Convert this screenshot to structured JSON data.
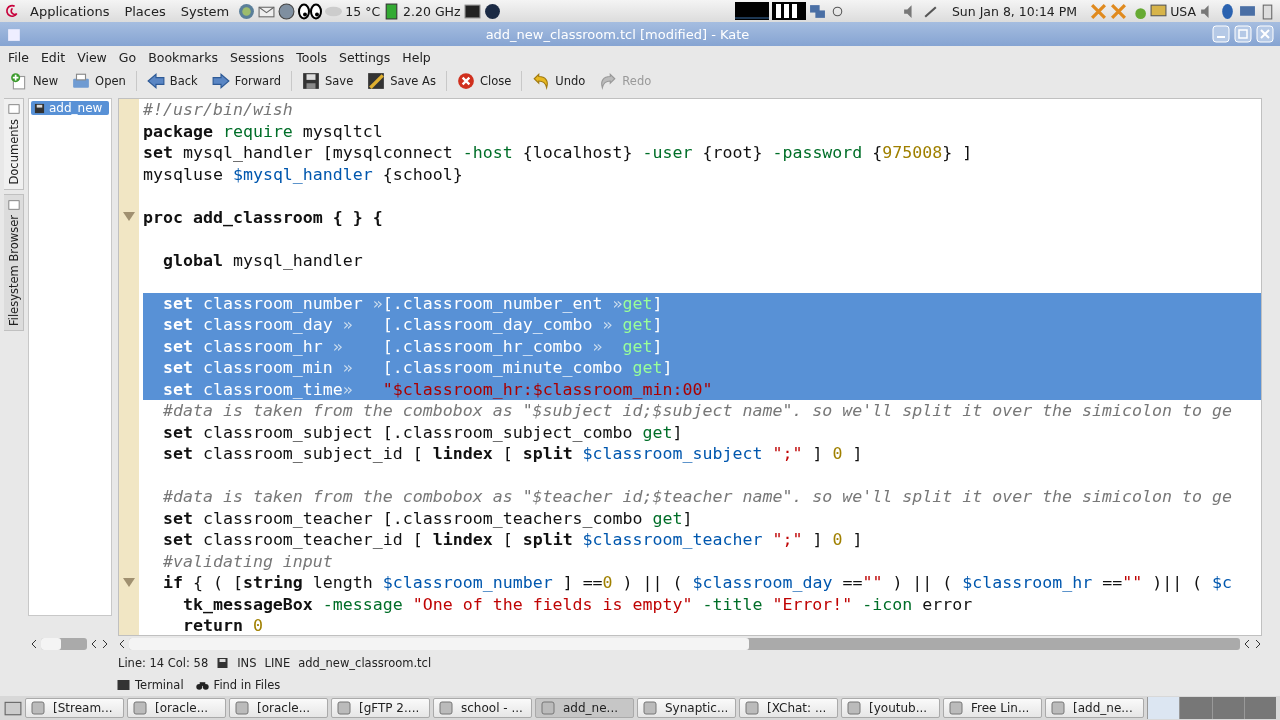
{
  "top_panel": {
    "menus": [
      "Applications",
      "Places",
      "System"
    ],
    "temperature": "15 °C",
    "cpu_speed": "2.20 GHz",
    "clock": "Sun Jan  8, 10:14 PM",
    "keyboard": "USA"
  },
  "window": {
    "title": "add_new_classroom.tcl [modified] - Kate"
  },
  "menu": [
    "File",
    "Edit",
    "View",
    "Go",
    "Bookmarks",
    "Sessions",
    "Tools",
    "Settings",
    "Help"
  ],
  "toolbar": [
    {
      "kind": "new",
      "label": "New",
      "disabled": false
    },
    {
      "kind": "open",
      "label": "Open",
      "disabled": false
    },
    {
      "kind": "back",
      "label": "Back",
      "disabled": false
    },
    {
      "kind": "forward",
      "label": "Forward",
      "disabled": false
    },
    {
      "kind": "save",
      "label": "Save",
      "disabled": false
    },
    {
      "kind": "saveas",
      "label": "Save As",
      "disabled": false
    },
    {
      "kind": "close",
      "label": "Close",
      "disabled": false
    },
    {
      "kind": "undo",
      "label": "Undo",
      "disabled": false
    },
    {
      "kind": "redo",
      "label": "Redo",
      "disabled": true
    }
  ],
  "side_tabs": [
    {
      "label": "Documents",
      "selected": true
    },
    {
      "label": "Filesystem Browser",
      "selected": false
    }
  ],
  "documents": [
    {
      "name": "add_new",
      "selected": true
    }
  ],
  "editor": {
    "lines": [
      {
        "selected": false,
        "fold": false,
        "tokens": [
          {
            "kind": "cmt",
            "text": "#!/usr/bin/wish"
          }
        ]
      },
      {
        "selected": false,
        "fold": false,
        "tokens": [
          {
            "kind": "kw",
            "text": "package"
          },
          {
            "kind": "cmd",
            "text": " require"
          },
          {
            "kind": "plain",
            "text": " mysqltcl"
          }
        ]
      },
      {
        "selected": false,
        "fold": false,
        "tokens": [
          {
            "kind": "kw",
            "text": "set"
          },
          {
            "kind": "plain",
            "text": " mysql_handler [mysqlconnect "
          },
          {
            "kind": "cmd",
            "text": "-host"
          },
          {
            "kind": "plain",
            "text": " {localhost} "
          },
          {
            "kind": "cmd",
            "text": "-user"
          },
          {
            "kind": "plain",
            "text": " {root} "
          },
          {
            "kind": "cmd",
            "text": "-password"
          },
          {
            "kind": "plain",
            "text": " {"
          },
          {
            "kind": "num",
            "text": "975008"
          },
          {
            "kind": "plain",
            "text": "} ]"
          }
        ]
      },
      {
        "selected": false,
        "fold": false,
        "tokens": [
          {
            "kind": "plain",
            "text": "mysqluse "
          },
          {
            "kind": "var",
            "text": "$mysql_handler"
          },
          {
            "kind": "plain",
            "text": " {school}"
          }
        ]
      },
      {
        "selected": false,
        "fold": false
      },
      {
        "selected": false,
        "fold": true,
        "tokens": [
          {
            "kind": "kw",
            "text": "proc add_classroom { } {"
          }
        ]
      },
      {
        "selected": false,
        "fold": false
      },
      {
        "selected": false,
        "fold": false,
        "tokens": [
          {
            "kind": "kw",
            "text": "  global"
          },
          {
            "kind": "plain",
            "text": " mysql_handler"
          }
        ]
      },
      {
        "selected": false,
        "fold": false
      },
      {
        "selected": true,
        "fold": false,
        "tokens": [
          {
            "kind": "kw",
            "text": "  set"
          },
          {
            "kind": "plain",
            "text": " classroom_number "
          },
          {
            "kind": "tab",
            "text": "»"
          },
          {
            "kind": "plain",
            "text": "[.classroom_number_ent "
          },
          {
            "kind": "tab",
            "text": "»"
          },
          {
            "kind": "cmd",
            "text": "get"
          },
          {
            "kind": "plain",
            "text": "]"
          }
        ]
      },
      {
        "selected": true,
        "fold": false,
        "tokens": [
          {
            "kind": "kw",
            "text": "  set"
          },
          {
            "kind": "plain",
            "text": " classroom_day "
          },
          {
            "kind": "tab",
            "text": "»"
          },
          {
            "kind": "plain",
            "text": "   [.classroom_day_combo "
          },
          {
            "kind": "tab",
            "text": "»"
          },
          {
            "kind": "cmd",
            "text": " get"
          },
          {
            "kind": "plain",
            "text": "]"
          }
        ]
      },
      {
        "selected": true,
        "fold": false,
        "tokens": [
          {
            "kind": "kw",
            "text": "  set"
          },
          {
            "kind": "plain",
            "text": " classroom_hr "
          },
          {
            "kind": "tab",
            "text": "»"
          },
          {
            "kind": "plain",
            "text": "    [.classroom_hr_combo "
          },
          {
            "kind": "tab",
            "text": "»"
          },
          {
            "kind": "cmd",
            "text": "  get"
          },
          {
            "kind": "plain",
            "text": "]"
          }
        ]
      },
      {
        "selected": true,
        "fold": false,
        "tokens": [
          {
            "kind": "kw",
            "text": "  set"
          },
          {
            "kind": "plain",
            "text": " classroom_min "
          },
          {
            "kind": "tab",
            "text": "»"
          },
          {
            "kind": "plain",
            "text": "   [.classroom_minute_combo "
          },
          {
            "kind": "cmd",
            "text": "get"
          },
          {
            "kind": "plain",
            "text": "]"
          }
        ]
      },
      {
        "selected": true,
        "fold": false,
        "tokens": [
          {
            "kind": "kw",
            "text": "  set"
          },
          {
            "kind": "plain",
            "text": " classroom_time"
          },
          {
            "kind": "tab",
            "text": "»"
          },
          {
            "kind": "str",
            "text": "   \"$classroom_hr:$classroom_min:00\""
          }
        ]
      },
      {
        "selected": false,
        "fold": false,
        "tokens": [
          {
            "kind": "cmt",
            "text": "  #data is taken from the combobox as \"$subject id;$subject name\". so we'll split it over the simicolon to ge"
          }
        ]
      },
      {
        "selected": false,
        "fold": false,
        "tokens": [
          {
            "kind": "kw",
            "text": "  set"
          },
          {
            "kind": "plain",
            "text": " classroom_subject [.classroom_subject_combo "
          },
          {
            "kind": "cmd",
            "text": "get"
          },
          {
            "kind": "plain",
            "text": "]"
          }
        ]
      },
      {
        "selected": false,
        "fold": false,
        "tokens": [
          {
            "kind": "kw",
            "text": "  set"
          },
          {
            "kind": "plain",
            "text": " classroom_subject_id [ "
          },
          {
            "kind": "kw",
            "text": "lindex"
          },
          {
            "kind": "plain",
            "text": " [ "
          },
          {
            "kind": "kw",
            "text": "split"
          },
          {
            "kind": "var",
            "text": " $classroom_subject"
          },
          {
            "kind": "str",
            "text": " \";\""
          },
          {
            "kind": "plain",
            "text": " ] "
          },
          {
            "kind": "num",
            "text": "0"
          },
          {
            "kind": "plain",
            "text": " ]"
          }
        ]
      },
      {
        "selected": false,
        "fold": false
      },
      {
        "selected": false,
        "fold": false,
        "tokens": [
          {
            "kind": "cmt",
            "text": "  #data is taken from the combobox as \"$teacher id;$teacher name\". so we'll split it over the simicolon to ge"
          }
        ]
      },
      {
        "selected": false,
        "fold": false,
        "tokens": [
          {
            "kind": "kw",
            "text": "  set"
          },
          {
            "kind": "plain",
            "text": " classroom_teacher [.classroom_teachers_combo "
          },
          {
            "kind": "cmd",
            "text": "get"
          },
          {
            "kind": "plain",
            "text": "]"
          }
        ]
      },
      {
        "selected": false,
        "fold": false,
        "tokens": [
          {
            "kind": "kw",
            "text": "  set"
          },
          {
            "kind": "plain",
            "text": " classroom_teacher_id [ "
          },
          {
            "kind": "kw",
            "text": "lindex"
          },
          {
            "kind": "plain",
            "text": " [ "
          },
          {
            "kind": "kw",
            "text": "split"
          },
          {
            "kind": "var",
            "text": " $classroom_teacher"
          },
          {
            "kind": "str",
            "text": " \";\""
          },
          {
            "kind": "plain",
            "text": " ] "
          },
          {
            "kind": "num",
            "text": "0"
          },
          {
            "kind": "plain",
            "text": " ]"
          }
        ]
      },
      {
        "selected": false,
        "fold": false,
        "tokens": [
          {
            "kind": "cmt",
            "text": "  #validating input"
          }
        ]
      },
      {
        "selected": false,
        "fold": true,
        "tokens": [
          {
            "kind": "kw",
            "text": "  if"
          },
          {
            "kind": "plain",
            "text": " { ( ["
          },
          {
            "kind": "kw",
            "text": "string"
          },
          {
            "kind": "plain",
            "text": " length "
          },
          {
            "kind": "var",
            "text": "$classroom_number"
          },
          {
            "kind": "plain",
            "text": " ] =="
          },
          {
            "kind": "num",
            "text": "0"
          },
          {
            "kind": "plain",
            "text": " ) || ( "
          },
          {
            "kind": "var",
            "text": "$classroom_day"
          },
          {
            "kind": "plain",
            "text": " =="
          },
          {
            "kind": "str",
            "text": "\"\""
          },
          {
            "kind": "plain",
            "text": " ) || ( "
          },
          {
            "kind": "var",
            "text": "$classroom_hr"
          },
          {
            "kind": "plain",
            "text": " =="
          },
          {
            "kind": "str",
            "text": "\"\""
          },
          {
            "kind": "plain",
            "text": " )|| ( "
          },
          {
            "kind": "var",
            "text": "$c"
          }
        ]
      },
      {
        "selected": false,
        "fold": false,
        "tokens": [
          {
            "kind": "kw",
            "text": "    tk_messageBox"
          },
          {
            "kind": "cmd",
            "text": " -message"
          },
          {
            "kind": "str",
            "text": " \"One of the fields is empty\""
          },
          {
            "kind": "cmd",
            "text": " -title"
          },
          {
            "kind": "str",
            "text": " \"Error!\""
          },
          {
            "kind": "cmd",
            "text": " -icon"
          },
          {
            "kind": "plain",
            "text": " error"
          }
        ]
      },
      {
        "selected": false,
        "fold": false,
        "tokens": [
          {
            "kind": "kw",
            "text": "    return"
          },
          {
            "kind": "num",
            "text": " 0"
          }
        ]
      }
    ]
  },
  "status_bar": {
    "position": "Line: 14 Col: 58",
    "input_mode": "INS",
    "selection_mode": "LINE",
    "file": "add_new_classroom.tcl"
  },
  "tool_views": [
    {
      "kind": "terminal",
      "label": "Terminal"
    },
    {
      "kind": "find",
      "label": "Find in Files"
    }
  ],
  "taskbar": [
    {
      "label": "[Stream...",
      "selected": false
    },
    {
      "label": "[oracle...",
      "selected": false
    },
    {
      "label": "[oracle...",
      "selected": false
    },
    {
      "label": "[gFTP 2....",
      "selected": false
    },
    {
      "label": "school - ...",
      "selected": false
    },
    {
      "label": "add_ne...",
      "selected": true
    },
    {
      "label": "Synaptic...",
      "selected": false
    },
    {
      "label": "[XChat: ...",
      "selected": false
    },
    {
      "label": "[youtub...",
      "selected": false
    },
    {
      "label": "Free Lin...",
      "selected": false
    },
    {
      "label": "[add_ne...",
      "selected": false
    }
  ]
}
